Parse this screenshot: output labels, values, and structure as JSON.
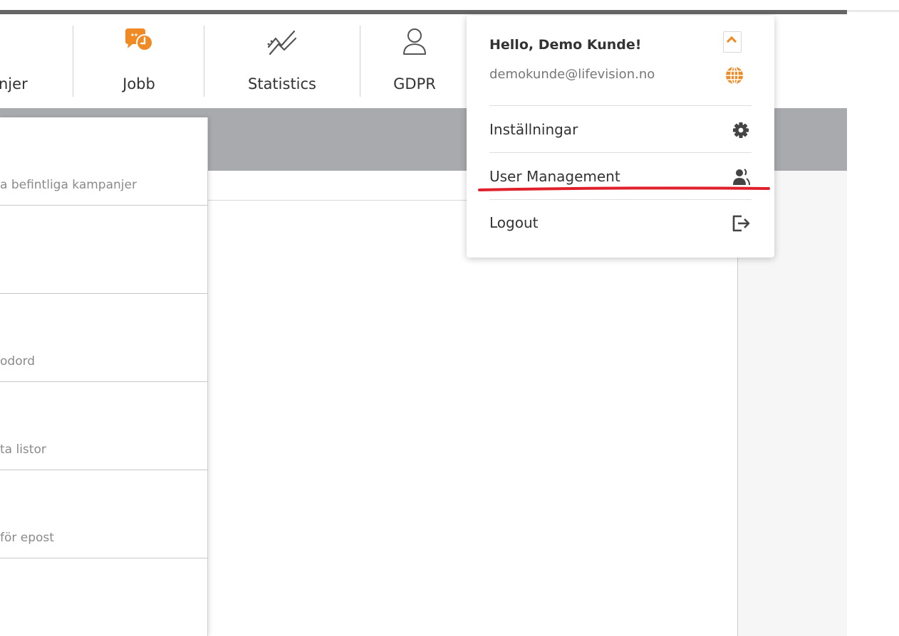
{
  "nav": {
    "items": [
      {
        "label": "njer",
        "icon": "campaigns-icon"
      },
      {
        "label": "Jobb",
        "icon": "chat-clock-icon"
      },
      {
        "label": "Statistics",
        "icon": "trend-chart-icon"
      },
      {
        "label": "GDPR",
        "icon": "user-outline-icon"
      }
    ],
    "active": "Jobb"
  },
  "jobb_menu": {
    "items": [
      {
        "desc": "a befintliga kampanjer"
      },
      {
        "desc": ""
      },
      {
        "desc": "odord"
      },
      {
        "desc": "ta listor"
      },
      {
        "desc": "för epost"
      },
      {
        "desc": ""
      }
    ]
  },
  "user_menu": {
    "greeting": "Hello, Demo Kunde!",
    "email": "demokunde@lifevision.no",
    "items": [
      {
        "label": "Inställningar",
        "icon": "gear-icon"
      },
      {
        "label": "User Management",
        "icon": "users-icon"
      },
      {
        "label": "Logout",
        "icon": "logout-icon"
      }
    ]
  },
  "colors": {
    "accent": "#f08a24",
    "annotation": "#e0202a",
    "header_strip": "#a9aaad"
  }
}
